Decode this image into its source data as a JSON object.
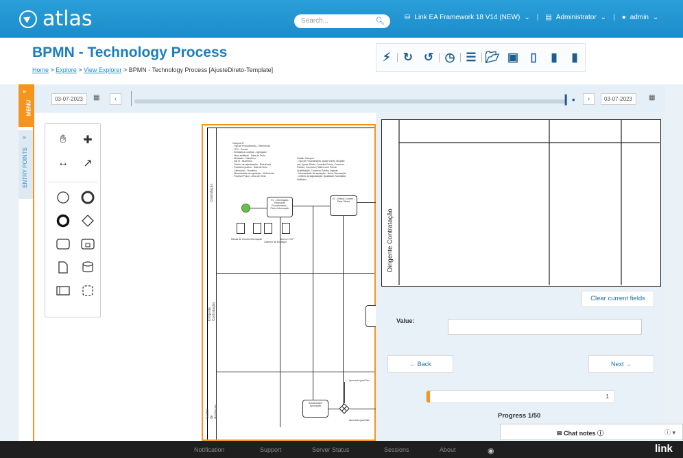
{
  "app": {
    "logo": "atlas",
    "search_placeholder": "Search...",
    "framework": "Link EA Framework 18 V14 (NEW)",
    "role": "Administrator",
    "user": "admin"
  },
  "page": {
    "title": "BPMN - Technology Process",
    "breadcrumb": {
      "home": "Home",
      "explore": "Explore",
      "view_explorer": "View Explorer",
      "current": "BPMN - Technology Process [AjusteDireto-Template]"
    }
  },
  "side": {
    "menu": "MENU",
    "entry_points": "ENTRY POINTS"
  },
  "timeline": {
    "start_date": "03-07-2023",
    "end_date": "03-07-2023"
  },
  "diagram": {
    "note1": "Campos:5*\n- Tipo de Procedimento - Referência\n- CPV - Escola\n- Entidade a convidar - Agregado\n- Nova entidade - Data de Texto\n- Montante - Numérico\n- IVA % - Numérico\n- Critério de adjudicação - Referência\n- Possíveis prazos - Data de texto\n- Cabimento - Numérico\n- Necessidade de aquisição - Referência\n- Possível Prazo - Área de Texto",
    "note2": "Gestão Campos:\n- Tipo de Procedimento: Ajuste Direto Simplific\nado, Ajuste Direto, Consulta Prévia, Concurso\nPúblico, Concurso Público com Prévia\nQualificação, Concurso Público urgente\n- Necessidade de aquisição - Nova, Renovação\n- Critério de adjudicação: Qualidade, Monofator,\nMultifator",
    "task1": "E1 - Informação Relevante Procedimento - Ficha Informação",
    "task2": "E2 - Efetua Convite - Para Oferta",
    "task3": "Solucionador Aprovação",
    "lane1": "Contratação",
    "lane2": "Dirigente Contratação",
    "lane3": "Gestor de Ambiente",
    "docs": [
      "Minuta de Convite",
      "Informação",
      "Caderno de Encargos",
      "Anexo I CCP"
    ],
    "gate1": "Aprovado igual Sim",
    "gate2": "Aprovado igual Não"
  },
  "panel": {
    "lane_label": "Dirigente Contratação",
    "clear_label": "Clear current fields",
    "value_label": "Value:",
    "value": "",
    "back_label": "← Back",
    "next_label": "Next →",
    "progress_value": "1",
    "progress_fraction": 0.02,
    "progress_label": "Progress 1/50"
  },
  "chat": {
    "label": "Chat notes"
  },
  "footer": {
    "notification": "Notification",
    "support": "Support",
    "server_status": "Server Status",
    "sessions": "Sessions",
    "about": "About",
    "brand": "link"
  },
  "colors": {
    "topbar": "#1c8ccb",
    "accent": "#f7941d",
    "title": "#1c7ebd",
    "start_event": "#6cc04a"
  }
}
